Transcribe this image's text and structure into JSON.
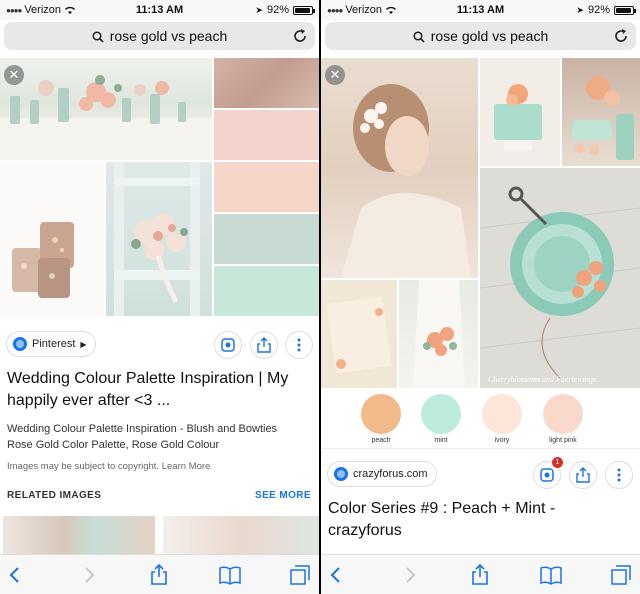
{
  "status": {
    "carrier": "Verizon",
    "time": "11:13 AM",
    "battery": "92%",
    "battery_level": 0.92
  },
  "search": {
    "query": "rose gold vs peach"
  },
  "left": {
    "source": "Pinterest",
    "title": "Wedding Colour Palette Inspiration | My happily ever after <3 ...",
    "desc_line1": "Wedding Colour Palette Inspiration - Blush and Bowties",
    "desc_line2": "Rose Gold Color Palette, Rose Gold Colour",
    "copyright": "Images may be subject to copyright. Learn More",
    "related_heading": "RELATED IMAGES",
    "see_more": "SEE MORE",
    "palette": [
      "#c9a899",
      "#f3d3cb",
      "#f6d6c9",
      "#c7dbd3",
      "#c7e8d8"
    ]
  },
  "right": {
    "source": "crazyforus.com",
    "badge_count": "1",
    "title": "Color Series #9 : Peach + Mint - crazyforus",
    "watermark": "Cherryblossoms and Faeriewings",
    "swatches": [
      {
        "name": "peach",
        "color": "#f2b98a"
      },
      {
        "name": "mint",
        "color": "#bcebdd"
      },
      {
        "name": "ivory",
        "color": "#fbe6d9"
      },
      {
        "name": "light pink",
        "color": "#f9d9cc"
      }
    ]
  },
  "colors": {
    "link_blue": "#1a73e8",
    "urlbar_bg": "#e8e8ea",
    "toolbar_bg": "#f7f7f7"
  },
  "icons": [
    "search-icon",
    "reload-icon",
    "close-icon",
    "globe-icon",
    "lens-icon",
    "share-icon",
    "more-icon",
    "back-icon",
    "forward-icon",
    "bookmarks-icon",
    "tabs-icon"
  ]
}
